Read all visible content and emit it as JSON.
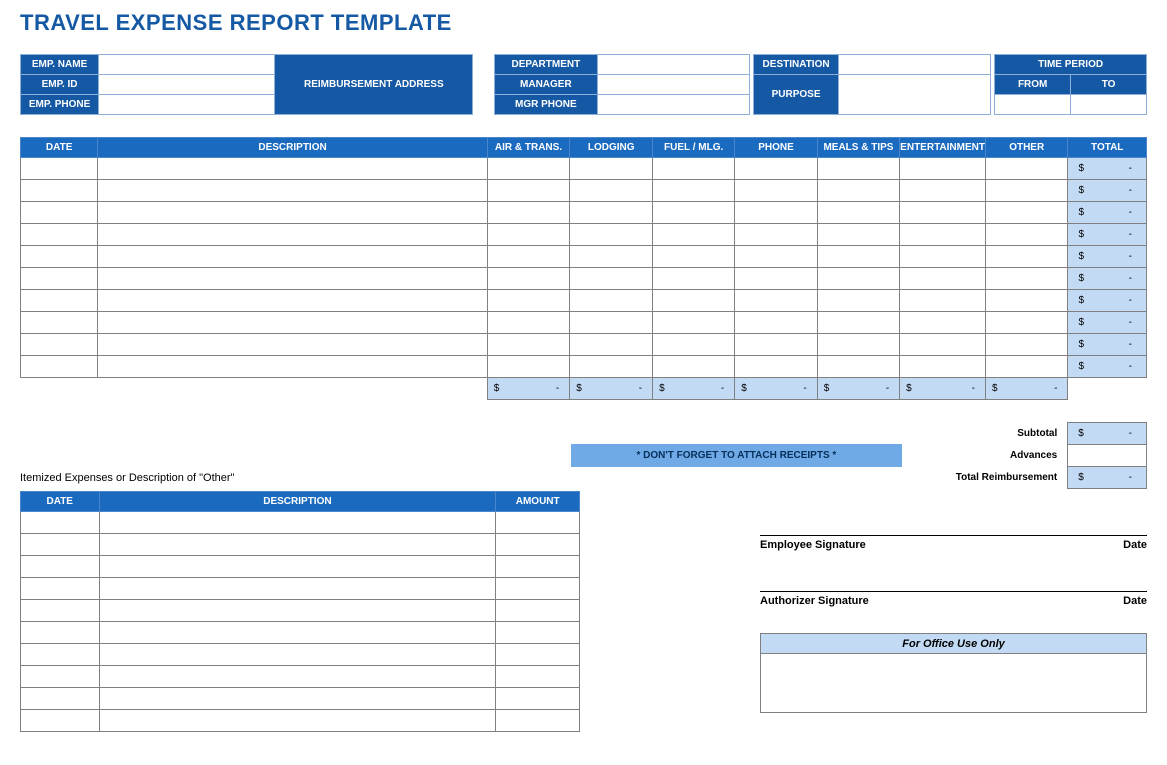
{
  "title": "TRAVEL EXPENSE REPORT TEMPLATE",
  "info": {
    "emp_name": "EMP. NAME",
    "emp_id": "EMP. ID",
    "emp_phone": "EMP. PHONE",
    "reimb_addr": "REIMBURSEMENT ADDRESS",
    "department": "DEPARTMENT",
    "manager": "MANAGER",
    "mgr_phone": "MGR PHONE",
    "destination": "DESTINATION",
    "purpose": "PURPOSE",
    "time_period": "TIME PERIOD",
    "from": "FROM",
    "to": "TO"
  },
  "expense_headers": {
    "date": "DATE",
    "description": "DESCRIPTION",
    "air": "AIR & TRANS.",
    "lodging": "LODGING",
    "fuel": "FUEL / MLG.",
    "phone": "PHONE",
    "meals": "MEALS & TIPS",
    "entertainment": "ENTERTAINMENT",
    "other": "OTHER",
    "total": "TOTAL"
  },
  "currency": "$",
  "dash": "-",
  "summary": {
    "subtotal": "Subtotal",
    "advances": "Advances",
    "total_reimb": "Total Reimbursement",
    "receipts_note": "* DON'T FORGET TO ATTACH RECEIPTS *"
  },
  "itemized": {
    "label": "Itemized Expenses or Description of \"Other\"",
    "date": "DATE",
    "description": "DESCRIPTION",
    "amount": "AMOUNT"
  },
  "signatures": {
    "employee": "Employee Signature",
    "authorizer": "Authorizer Signature",
    "date": "Date"
  },
  "office": {
    "header": "For Office Use Only"
  }
}
